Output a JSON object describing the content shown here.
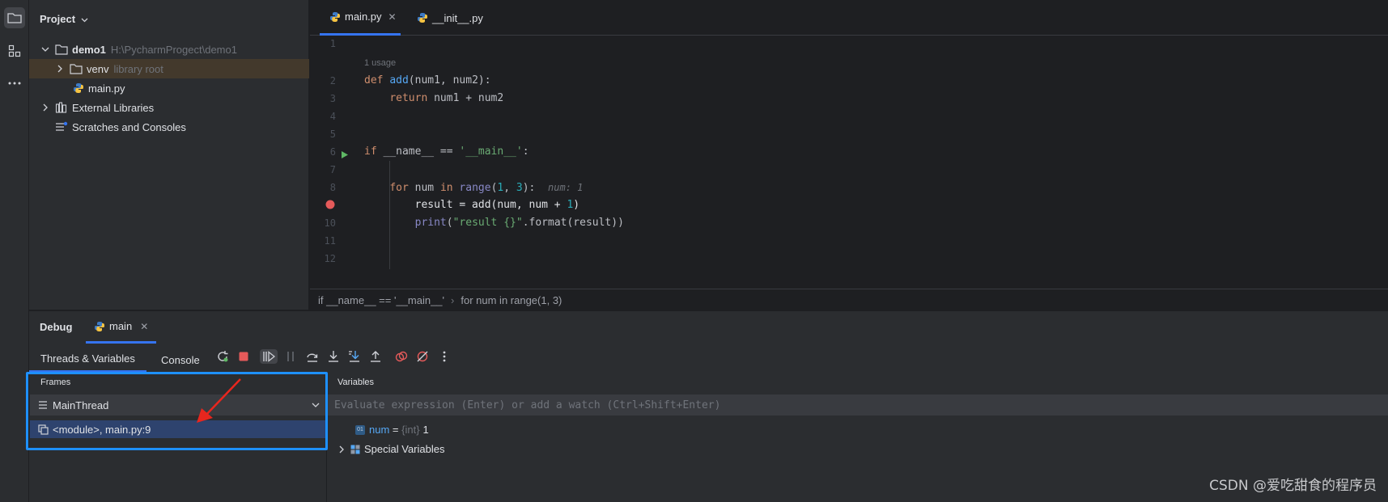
{
  "project": {
    "title": "Project",
    "tree": [
      {
        "label": "demo1",
        "detail": "H:\\PycharmProgect\\demo1"
      },
      {
        "label": "venv",
        "detail": "library root"
      },
      {
        "label": "main.py",
        "detail": ""
      },
      {
        "label": "External Libraries",
        "detail": ""
      },
      {
        "label": "Scratches and Consoles",
        "detail": ""
      }
    ]
  },
  "editor": {
    "tabs": [
      {
        "label": "main.py",
        "active": true
      },
      {
        "label": "__init__.py",
        "active": false
      }
    ],
    "line_numbers": [
      "1",
      "2",
      "3",
      "4",
      "5",
      "6",
      "7",
      "8",
      "9",
      "10",
      "11",
      "12"
    ],
    "usage_hint": "1 usage",
    "inline_hint": "num: 1",
    "code_lines": [
      "",
      "def add(num1, num2):",
      "    return num1 + num2",
      "",
      "",
      "if __name__ == '__main__':",
      "",
      "    for num in range(1, 3):",
      "        result = add(num, num + 1)",
      "        print(\"result {}\".format(result))",
      "",
      ""
    ],
    "breadcrumb": [
      "if __name__ == '__main__'",
      "for num in range(1, 3)"
    ]
  },
  "debug": {
    "title": "Debug",
    "session_tab": "main",
    "subtabs": [
      "Threads & Variables",
      "Console"
    ],
    "frames_header": "Frames",
    "thread": "MainThread",
    "frame": "<module>, main.py:9",
    "variables_header": "Variables",
    "eval_placeholder": "Evaluate expression (Enter) or add a watch (Ctrl+Shift+Enter)",
    "variables": [
      {
        "name": "num",
        "eq": " = ",
        "type": "{int}",
        "value": "1"
      },
      {
        "name": "Special Variables"
      }
    ]
  },
  "watermark": "CSDN @爱吃甜食的程序员",
  "colors": {
    "accent": "#3574f0",
    "exec_line": "#214283",
    "breakpoint": "#e55a5a",
    "highlight_box": "#1e90ff",
    "arrow": "#e8261e"
  }
}
